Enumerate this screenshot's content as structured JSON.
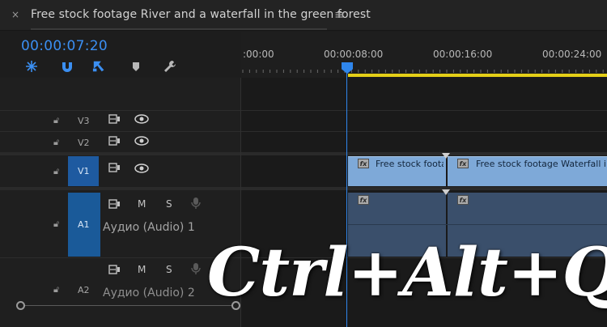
{
  "tab": {
    "title": "Free stock footage River and a waterfall in the green forest",
    "close_glyph": "×",
    "menu_glyph": "≡"
  },
  "timeline": {
    "timecode": "00:00:07:20",
    "ruler_labels": [
      ":00:00",
      "00:00:08:00",
      "00:00:16:00",
      "00:00:24:00"
    ],
    "tools": [
      "snap-icon",
      "magnet-link-icon",
      "linked-selection-icon",
      "add-marker-icon",
      "wrench-icon"
    ]
  },
  "tracks": {
    "v3": {
      "label": "V3"
    },
    "v2": {
      "label": "V2"
    },
    "v1": {
      "label": "V1"
    },
    "a1": {
      "label": "A1",
      "name": "Аудио (Audio) 1",
      "mute": "M",
      "solo": "S"
    },
    "a2": {
      "label": "A2",
      "name": "Аудио (Audio) 2",
      "mute": "M",
      "solo": "S"
    }
  },
  "clips": {
    "video": [
      {
        "label": "Free stock foota",
        "fx": "fx"
      },
      {
        "label": "Free stock footage Waterfall in th",
        "fx": "fx"
      }
    ],
    "audio": [
      {
        "fx": "fx"
      },
      {
        "fx": "fx"
      }
    ]
  },
  "overlay": {
    "shortcut": "Ctrl+Alt+Q"
  },
  "colors": {
    "timecode": "#3b8ff2",
    "playhead": "#2f86ec",
    "work_area": "#e4cf17",
    "video_clip": "#7ea9d8",
    "audio_clip": "#3a4f6b",
    "track_target": "#1e5aa0"
  }
}
